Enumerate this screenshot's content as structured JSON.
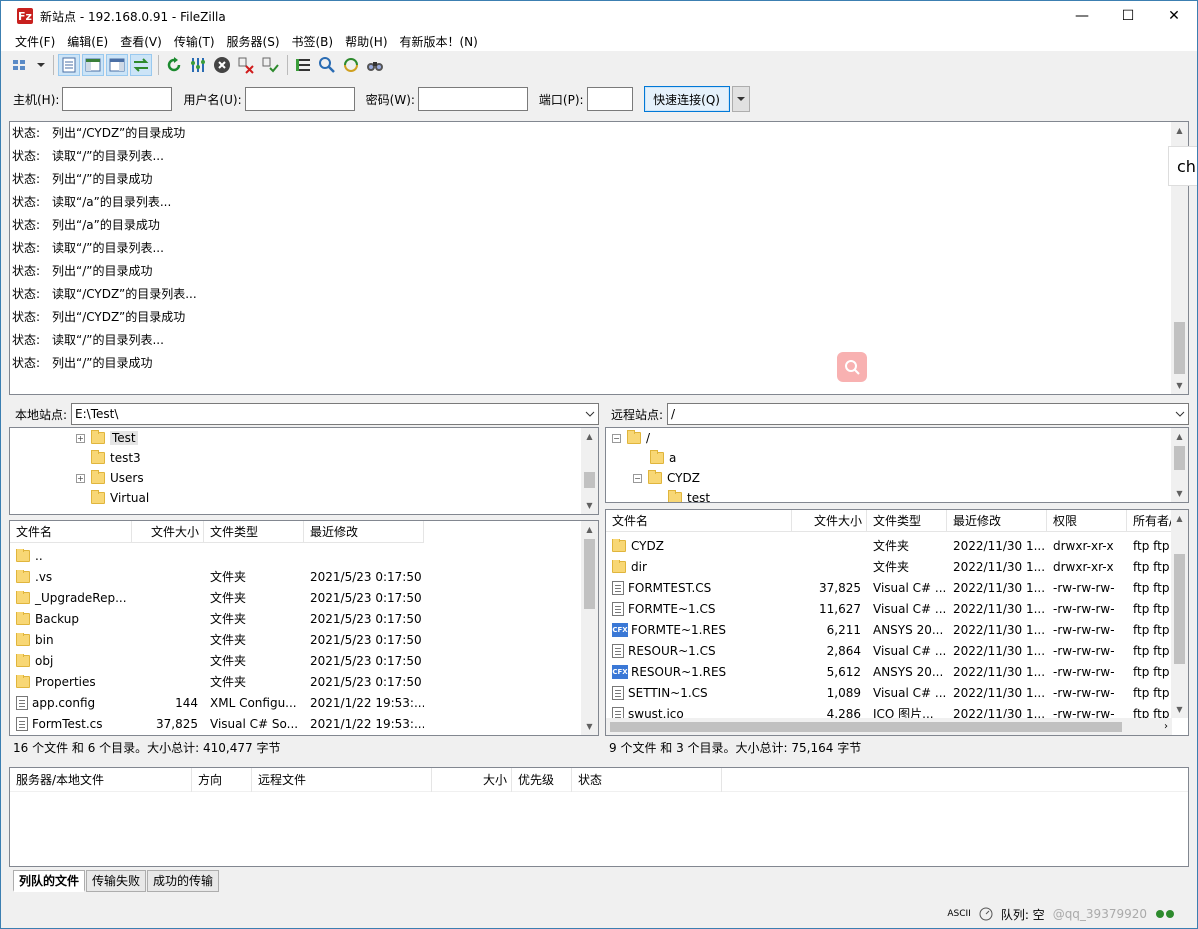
{
  "window": {
    "title": "新站点 - 192.168.0.91 - FileZilla",
    "icon_letter": "Fz",
    "minimize": "—",
    "maximize": "☐",
    "close": "✕"
  },
  "menu": [
    "文件(F)",
    "编辑(E)",
    "查看(V)",
    "传输(T)",
    "服务器(S)",
    "书签(B)",
    "帮助(H)",
    "有新版本！(N)"
  ],
  "quickconnect": {
    "host_label": "主机(H):",
    "user_label": "用户名(U):",
    "pass_label": "密码(W):",
    "port_label": "端口(P):",
    "button": "快速连接(Q)",
    "host_value": "",
    "user_value": "",
    "pass_value": "",
    "port_value": ""
  },
  "log": {
    "lines": [
      {
        "label": "状态:",
        "text": "列出“/CYDZ”的目录成功"
      },
      {
        "label": "状态:",
        "text": "读取“/”的目录列表..."
      },
      {
        "label": "状态:",
        "text": "列出“/”的目录成功"
      },
      {
        "label": "状态:",
        "text": "读取“/a”的目录列表..."
      },
      {
        "label": "状态:",
        "text": "列出“/a”的目录成功"
      },
      {
        "label": "状态:",
        "text": "读取“/”的目录列表..."
      },
      {
        "label": "状态:",
        "text": "列出“/”的目录成功"
      },
      {
        "label": "状态:",
        "text": "读取“/CYDZ”的目录列表..."
      },
      {
        "label": "状态:",
        "text": "列出“/CYDZ”的目录成功"
      },
      {
        "label": "状态:",
        "text": "读取“/”的目录列表..."
      },
      {
        "label": "状态:",
        "text": "列出“/”的目录成功"
      }
    ]
  },
  "overlay_chip": "cha",
  "local": {
    "site_label": "本地站点:",
    "path": "E:\\Test\\",
    "tree": [
      {
        "name": "Test",
        "expander": "+",
        "indent": 1
      },
      {
        "name": "test3",
        "expander": "",
        "indent": 1
      },
      {
        "name": "Users",
        "expander": "+",
        "indent": 1
      },
      {
        "name": "Virtual",
        "expander": "",
        "indent": 1
      }
    ],
    "columns": [
      "文件名",
      "文件大小",
      "文件类型",
      "最近修改"
    ],
    "files": [
      {
        "name": "..",
        "size": "",
        "type": "",
        "modified": "",
        "icon": "folder"
      },
      {
        "name": ".vs",
        "size": "",
        "type": "文件夹",
        "modified": "2021/5/23 0:17:50",
        "icon": "folder"
      },
      {
        "name": "_UpgradeRep...",
        "size": "",
        "type": "文件夹",
        "modified": "2021/5/23 0:17:50",
        "icon": "folder"
      },
      {
        "name": "Backup",
        "size": "",
        "type": "文件夹",
        "modified": "2021/5/23 0:17:50",
        "icon": "folder"
      },
      {
        "name": "bin",
        "size": "",
        "type": "文件夹",
        "modified": "2021/5/23 0:17:50",
        "icon": "folder"
      },
      {
        "name": "obj",
        "size": "",
        "type": "文件夹",
        "modified": "2021/5/23 0:17:50",
        "icon": "folder"
      },
      {
        "name": "Properties",
        "size": "",
        "type": "文件夹",
        "modified": "2021/5/23 0:17:50",
        "icon": "folder"
      },
      {
        "name": "app.config",
        "size": "144",
        "type": "XML Configu...",
        "modified": "2021/1/22 19:53:...",
        "icon": "file"
      },
      {
        "name": "FormTest.cs",
        "size": "37,825",
        "type": "Visual C# So...",
        "modified": "2021/1/22 19:53:...",
        "icon": "file"
      }
    ],
    "summary": "16 个文件 和 6 个目录。大小总计: 410,477 字节"
  },
  "remote": {
    "site_label": "远程站点:",
    "path": "/",
    "tree": [
      {
        "name": "/",
        "expander": "−",
        "indent": 0
      },
      {
        "name": "a",
        "expander": "",
        "indent": 1
      },
      {
        "name": "CYDZ",
        "expander": "−",
        "indent": 1
      },
      {
        "name": "test",
        "expander": "",
        "indent": 2
      }
    ],
    "columns": [
      "文件名",
      "文件大小",
      "文件类型",
      "最近修改",
      "权限",
      "所有者/..."
    ],
    "files": [
      {
        "name": "CYDZ",
        "size": "",
        "type": "文件夹",
        "modified": "2022/11/30 1...",
        "perm": "drwxr-xr-x",
        "owner": "ftp ftp",
        "icon": "folder"
      },
      {
        "name": "dir",
        "size": "",
        "type": "文件夹",
        "modified": "2022/11/30 1...",
        "perm": "drwxr-xr-x",
        "owner": "ftp ftp",
        "icon": "folder"
      },
      {
        "name": "FORMTEST.CS",
        "size": "37,825",
        "type": "Visual C# ...",
        "modified": "2022/11/30 1...",
        "perm": "-rw-rw-rw-",
        "owner": "ftp ftp",
        "icon": "file"
      },
      {
        "name": "FORMTE~1.CS",
        "size": "11,627",
        "type": "Visual C# ...",
        "modified": "2022/11/30 1...",
        "perm": "-rw-rw-rw-",
        "owner": "ftp ftp",
        "icon": "file"
      },
      {
        "name": "FORMTE~1.RES",
        "size": "6,211",
        "type": "ANSYS 20...",
        "modified": "2022/11/30 1...",
        "perm": "-rw-rw-rw-",
        "owner": "ftp ftp",
        "icon": "cfx"
      },
      {
        "name": "RESOUR~1.CS",
        "size": "2,864",
        "type": "Visual C# ...",
        "modified": "2022/11/30 1...",
        "perm": "-rw-rw-rw-",
        "owner": "ftp ftp",
        "icon": "file"
      },
      {
        "name": "RESOUR~1.RES",
        "size": "5,612",
        "type": "ANSYS 20...",
        "modified": "2022/11/30 1...",
        "perm": "-rw-rw-rw-",
        "owner": "ftp ftp",
        "icon": "cfx"
      },
      {
        "name": "SETTIN~1.CS",
        "size": "1,089",
        "type": "Visual C# ...",
        "modified": "2022/11/30 1...",
        "perm": "-rw-rw-rw-",
        "owner": "ftp ftp",
        "icon": "file"
      },
      {
        "name": "swust.ico",
        "size": "4,286",
        "type": "ICO 图片...",
        "modified": "2022/11/30 1...",
        "perm": "-rw-rw-rw-",
        "owner": "ftp ftp",
        "icon": "file"
      }
    ],
    "summary": "9 个文件 和 3 个目录。大小总计: 75,164 字节"
  },
  "queue": {
    "columns": [
      "服务器/本地文件",
      "方向",
      "远程文件",
      "大小",
      "优先级",
      "状态"
    ]
  },
  "tabs": [
    "列队的文件",
    "传输失败",
    "成功的传输"
  ],
  "statusbar": {
    "ascii": "ASCII",
    "queue_label": "队列: 空",
    "watermark": "@qq_39379920"
  },
  "colors": {
    "accent": "#0078d7",
    "title_icon": "#c8201e",
    "folder": "#f8d775"
  }
}
